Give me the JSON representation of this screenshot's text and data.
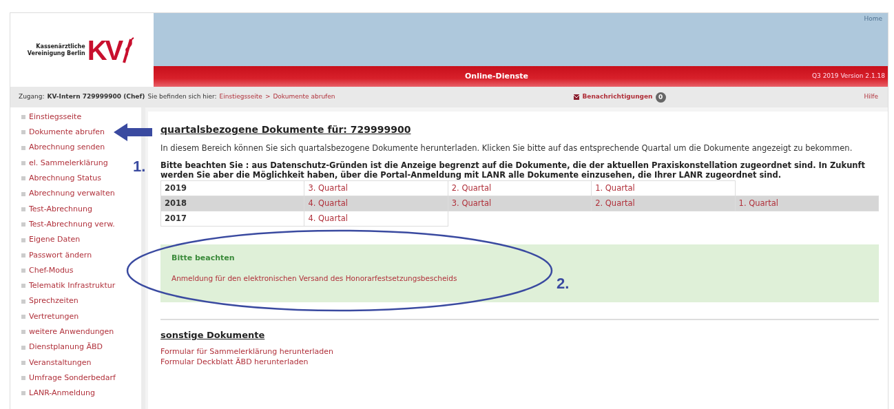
{
  "header": {
    "logo_text": [
      "Kassenärztliche",
      "Vereinigung Berlin"
    ],
    "logo_mark": "KV",
    "top_link": "Home",
    "title": "Online-Dienste",
    "version": "Q3 2019 Version 2.1.18"
  },
  "infobar": {
    "access_label": "Zugang:",
    "access_user": "KV-Intern 729999900 (Chef)",
    "location_label": "Sie befinden sich hier:",
    "breadcrumb": [
      "Einstiegsseite",
      "Dokumente abrufen"
    ],
    "breadcrumb_separator": ">",
    "notifications": "Benachrichtigungen",
    "notification_count": "0",
    "help": "Hilfe"
  },
  "sidebar": {
    "items": [
      {
        "label": "Einstiegsseite"
      },
      {
        "label": "Dokumente abrufen"
      },
      {
        "label": "Abrechnung senden"
      },
      {
        "label": "el. Sammelerklärung"
      },
      {
        "label": "Abrechnung Status"
      },
      {
        "label": "Abrechnung verwalten"
      },
      {
        "label": "Test-Abrechnung"
      },
      {
        "label": "Test-Abrechnung verw."
      },
      {
        "label": "Eigene Daten"
      },
      {
        "label": "Passwort ändern"
      },
      {
        "label": "Chef-Modus"
      },
      {
        "label": "Telematik Infrastruktur"
      },
      {
        "label": "Sprechzeiten"
      },
      {
        "label": "Vertretungen"
      },
      {
        "label": "weitere Anwendungen"
      },
      {
        "label": "Dienstplanung ÄBD"
      },
      {
        "label": "Veranstaltungen"
      },
      {
        "label": "Umfrage Sonderbedarf"
      },
      {
        "label": "LANR-Anmeldung"
      }
    ]
  },
  "main": {
    "title": "quartalsbezogene Dokumente für: 729999900",
    "intro": "In diesem Bereich können Sie sich quartalsbezogene Dokumente herunterladen. Klicken Sie bitte auf das entsprechende Quartal um die Dokumente angezeigt zu bekommen.",
    "notice": "Bitte beachten Sie : aus Datenschutz-Gründen ist die Anzeige begrenzt auf die Dokumente, die der aktuellen Praxiskonstellation zugeordnet sind. In Zukunft werden Sie aber die Möglichkeit haben, über die Portal-Anmeldung mit LANR alle Dokumente einzusehen, die Ihrer LANR zugeordnet sind.",
    "table": {
      "rows": [
        {
          "year": "2019",
          "highlighted": false,
          "quarters": [
            "3. Quartal",
            "2. Quartal",
            "1. Quartal"
          ]
        },
        {
          "year": "2018",
          "highlighted": true,
          "quarters": [
            "4. Quartal",
            "3. Quartal",
            "2. Quartal",
            "1. Quartal"
          ]
        },
        {
          "year": "2017",
          "highlighted": false,
          "quarters": [
            "4. Quartal"
          ]
        }
      ]
    },
    "alert": {
      "title": "Bitte beachten",
      "link": "Anmeldung für den elektronischen Versand des Honorarfestsetzungsbescheids"
    },
    "other_title": "sonstige Dokumente",
    "other_links": [
      "Formular für Sammelerklärung herunterladen",
      "Formular Deckblatt ÄBD herunterladen"
    ]
  },
  "annotations": [
    {
      "kind": "arrow",
      "label": "1."
    },
    {
      "kind": "ellipse",
      "label": "2."
    }
  ]
}
